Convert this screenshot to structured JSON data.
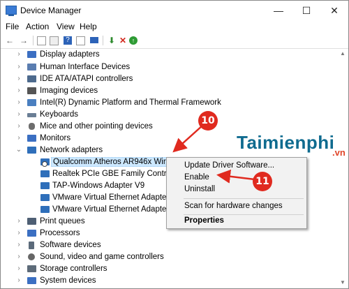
{
  "window": {
    "title": "Device Manager",
    "controls": {
      "minimize": "—",
      "maximize": "☐",
      "close": "✕"
    }
  },
  "menu": [
    "File",
    "Action",
    "View",
    "Help"
  ],
  "toolbar": {
    "buttons": [
      "back-icon",
      "forward-icon",
      "properties-icon",
      "grid-icon",
      "help-icon",
      "monitor-icon",
      "update-driver-icon",
      "remove-device-icon",
      "enable-device-icon"
    ]
  },
  "tree": {
    "items": [
      {
        "label": "Display adapters",
        "icon": "display-icon",
        "color": "#3b6fc2"
      },
      {
        "label": "Human Interface Devices",
        "icon": "hid-icon",
        "color": "#5a7db0"
      },
      {
        "label": "IDE ATA/ATAPI controllers",
        "icon": "ide-icon",
        "color": "#4d6a8d"
      },
      {
        "label": "Imaging devices",
        "icon": "camera-icon",
        "color": "#555555"
      },
      {
        "label": "Intel(R) Dynamic Platform and Thermal Framework",
        "icon": "chip-icon",
        "color": "#4a7fc0"
      },
      {
        "label": "Keyboards",
        "icon": "keyboard-icon",
        "color": "#6a7e95"
      },
      {
        "label": "Mice and other pointing devices",
        "icon": "mouse-icon",
        "color": "#6d6d6d"
      },
      {
        "label": "Monitors",
        "icon": "monitor-icon",
        "color": "#3b6fc2"
      },
      {
        "label": "Network adapters",
        "icon": "network-icon",
        "color": "#2f6fba"
      },
      {
        "label": "Qualcomm Atheros AR946x Wireless Network Adapter",
        "icon": "network-adapter-icon",
        "color": "#2f6fba"
      },
      {
        "label": "Realtek PCIe GBE Family Controller",
        "icon": "network-adapter-icon",
        "color": "#2f6fba"
      },
      {
        "label": "TAP-Windows Adapter V9",
        "icon": "network-adapter-icon",
        "color": "#2f6fba"
      },
      {
        "label": "VMware Virtual Ethernet Adapter",
        "icon": "network-adapter-icon",
        "color": "#2f6fba"
      },
      {
        "label": "VMware Virtual Ethernet Adapter",
        "icon": "network-adapter-icon",
        "color": "#2f6fba"
      },
      {
        "label": "Print queues",
        "icon": "printer-icon",
        "color": "#4e5f74"
      },
      {
        "label": "Processors",
        "icon": "cpu-icon",
        "color": "#3b6fc2"
      },
      {
        "label": "Software devices",
        "icon": "software-icon",
        "color": "#5b6a7a"
      },
      {
        "label": "Sound, video and game controllers",
        "icon": "speaker-icon",
        "color": "#666666"
      },
      {
        "label": "Storage controllers",
        "icon": "storage-icon",
        "color": "#5d6b79"
      },
      {
        "label": "System devices",
        "icon": "system-icon",
        "color": "#3b6fc2"
      }
    ]
  },
  "context_menu": {
    "items": [
      {
        "label": "Update Driver Software...",
        "bold": false
      },
      {
        "label": "Enable",
        "bold": false
      },
      {
        "label": "Uninstall",
        "bold": false
      },
      {
        "label": "Scan for hardware changes",
        "bold": false
      },
      {
        "label": "Properties",
        "bold": true
      }
    ]
  },
  "annotations": {
    "badge_1": "10",
    "badge_2": "11",
    "arrow_color": "#e02a1f"
  },
  "watermark": {
    "text": "Taimienphi",
    "suffix": ".vn"
  }
}
